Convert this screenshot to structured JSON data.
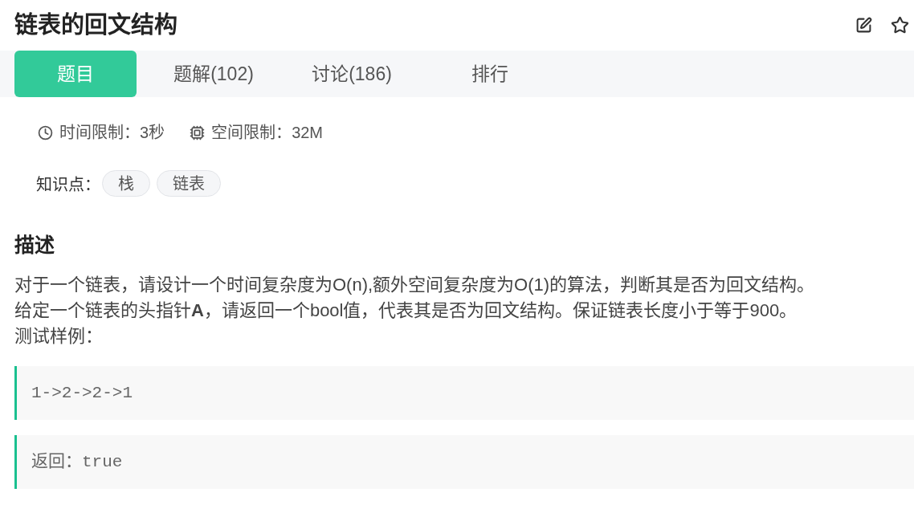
{
  "header": {
    "title": "链表的回文结构"
  },
  "tabs": [
    {
      "label": "题目",
      "selected": true
    },
    {
      "label": "题解(102)",
      "selected": false
    },
    {
      "label": "讨论(186)",
      "selected": false
    },
    {
      "label": "排行",
      "selected": false
    }
  ],
  "limits": [
    {
      "kind": "time",
      "text": "时间限制：3秒"
    },
    {
      "kind": "memory",
      "text": "空间限制：32M"
    }
  ],
  "knowledge": {
    "label": "知识点：",
    "tags": [
      "栈",
      "链表"
    ]
  },
  "description": {
    "heading": "描述",
    "paragraphs": [
      "对于一个链表，请设计一个时间复杂度为O(n),额外空间复杂度为O(1)的算法，判断其是否为回文结构。",
      "给定一个链表的头指针**A**，请返回一个bool值，代表其是否为回文结构。保证链表长度小于等于900。",
      "测试样例："
    ]
  },
  "code_blocks": [
    "1->2->2->1",
    "返回：true"
  ]
}
